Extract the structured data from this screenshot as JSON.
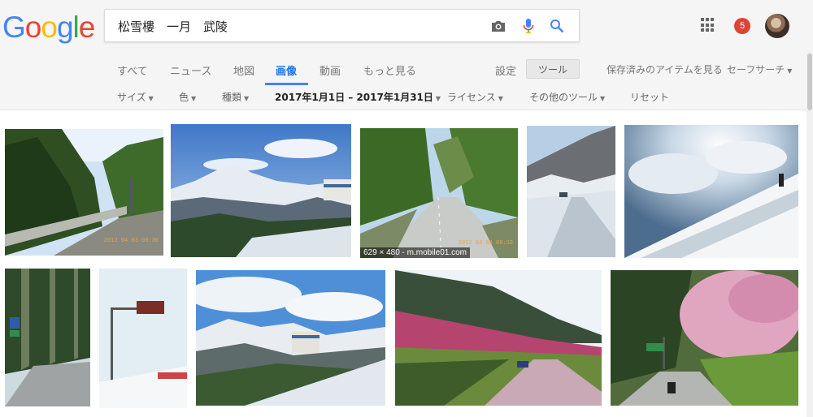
{
  "logo": {
    "letters": [
      "G",
      "o",
      "o",
      "g",
      "l",
      "e"
    ],
    "colors": [
      "#4285F4",
      "#EA4335",
      "#FBBC05",
      "#4285F4",
      "#34A853",
      "#EA4335"
    ]
  },
  "search": {
    "query": "松雪樓　一月　武陵"
  },
  "icons": {
    "camera": "camera-icon",
    "mic": "microphone-icon",
    "search": "search-icon",
    "apps": "apps-grid-icon"
  },
  "notifications": {
    "count": "5"
  },
  "tabs": [
    {
      "label": "すべて",
      "active": false
    },
    {
      "label": "ニュース",
      "active": false
    },
    {
      "label": "地図",
      "active": false
    },
    {
      "label": "画像",
      "active": true
    },
    {
      "label": "動画",
      "active": false
    },
    {
      "label": "もっと見る",
      "active": false
    }
  ],
  "settings_label": "設定",
  "tools_label": "ツール",
  "saved_label": "保存済みのアイテムを見る",
  "safesearch_label": "セーフサーチ",
  "toolbar": {
    "size": "サイズ",
    "color": "色",
    "type": "種類",
    "date": "2017年1月1日 – 2017年1月31日",
    "license": "ライセンス",
    "other": "その他のツール",
    "reset": "リセット"
  },
  "results": [
    {
      "desc": "roadside-forest",
      "stamp": "2012 04 03 09:30"
    },
    {
      "desc": "snowy-mountain-range",
      "stamp": ""
    },
    {
      "desc": "spring-road",
      "stamp": "2012 04 03 09:33",
      "label": "629 × 480 - m.mobile01.com"
    },
    {
      "desc": "snow-road",
      "stamp": ""
    },
    {
      "desc": "climber-snow-slope",
      "stamp": ""
    },
    {
      "desc": "forest-road-sign",
      "stamp": ""
    },
    {
      "desc": "snow-road-sign",
      "stamp": ""
    },
    {
      "desc": "snowy-lodge",
      "stamp": ""
    },
    {
      "desc": "cherry-blossom-valley",
      "stamp": ""
    },
    {
      "desc": "cherry-blossom-road",
      "stamp": ""
    }
  ],
  "colors": {
    "accent": "#4285F4",
    "active_tab": "#1A73E8",
    "badge": "#DB4437"
  }
}
